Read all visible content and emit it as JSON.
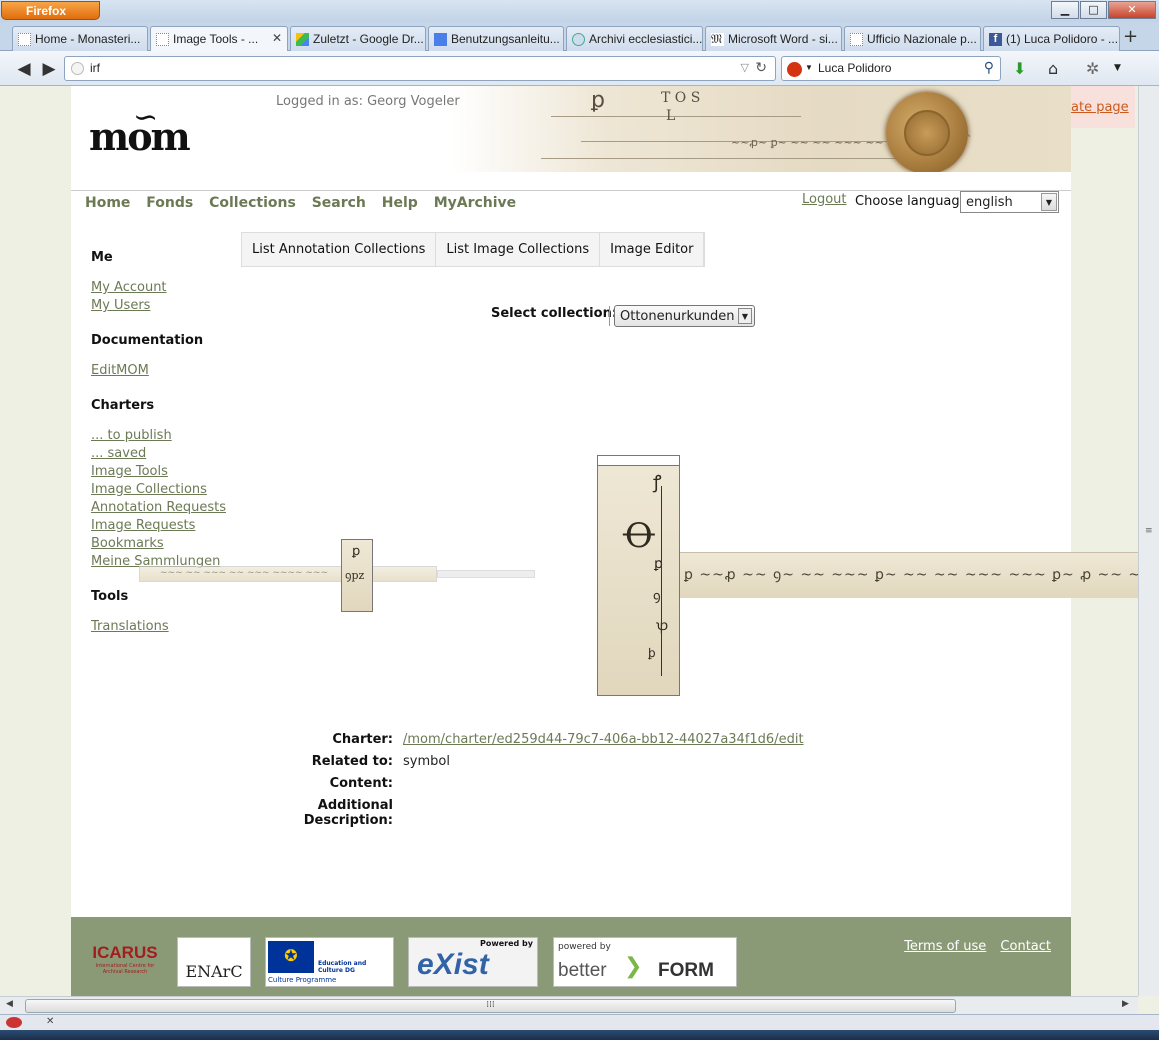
{
  "browser": {
    "menu_label": "Firefox",
    "tabs": [
      {
        "label": "Home - Monasteri...",
        "active": false
      },
      {
        "label": "Image Tools - ...",
        "active": true
      },
      {
        "label": "Zuletzt - Google Dr...",
        "active": false
      },
      {
        "label": "Benutzungsanleitu...",
        "active": false
      },
      {
        "label": "Archivi ecclesiastici...",
        "active": false
      },
      {
        "label": "Microsoft Word - si...",
        "active": false
      },
      {
        "label": "Ufficio Nazionale p...",
        "active": false
      },
      {
        "label": "(1) Luca Polidoro - ...",
        "active": false
      }
    ],
    "new_tab": "+",
    "url": "irf",
    "search_value": "Luca Polidoro"
  },
  "header": {
    "logo": "mom",
    "logged_in_label": "Logged in as:",
    "user_name": "Georg Vogeler",
    "create_page": "ate page"
  },
  "nav": {
    "items": [
      "Home",
      "Fonds",
      "Collections",
      "Search",
      "Help",
      "MyArchive"
    ],
    "logout": "Logout",
    "language_label": "Choose language",
    "language_value": "english"
  },
  "sidebar": {
    "sections": [
      {
        "title": "Me",
        "links": [
          "My Account",
          "My Users"
        ]
      },
      {
        "title": "Documentation",
        "links": [
          "EditMOM"
        ]
      },
      {
        "title": "Charters",
        "links": [
          "... to publish",
          "... saved",
          "Image Tools",
          "Image Collections",
          "Annotation Requests",
          "Image Requests",
          "Bookmarks",
          "Meine Sammlungen"
        ]
      },
      {
        "title": "Tools",
        "links": [
          "Translations"
        ]
      }
    ]
  },
  "subtabs": [
    "List Annotation Collections",
    "List Image Collections",
    "Image Editor"
  ],
  "collection": {
    "label": "Select collection:",
    "value": "Ottonenurkunden"
  },
  "details": {
    "charter_label": "Charter:",
    "charter_value": "/mom/charter/ed259d44-79c7-406a-bb12-44027a34f1d6/edit",
    "related_label": "Related to:",
    "related_value": "symbol",
    "content_label": "Content:",
    "content_value": "",
    "additional_label": "Additional Description:",
    "additional_value": ""
  },
  "footer": {
    "links": [
      "Terms of use",
      "Contact"
    ],
    "logos": [
      "ICARUS",
      "International Centre for Archival Research",
      "ENArC",
      "Education and Culture DG",
      "Culture Programme",
      "Powered by",
      "eXist",
      "powered by",
      "better",
      "FORM"
    ]
  },
  "colors": {
    "nav_green": "#6b7a55",
    "footer_green": "#8a9a77",
    "create_orange": "#cc5a1c"
  }
}
